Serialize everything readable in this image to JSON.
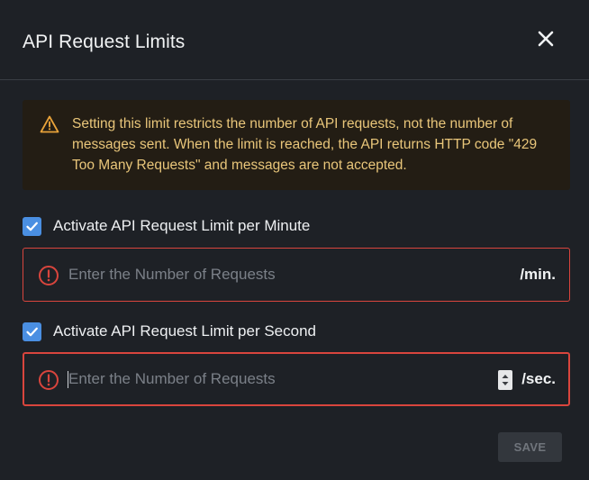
{
  "dialog": {
    "title": "API Request Limits",
    "close_icon": "close-icon"
  },
  "warning": {
    "icon": "warning-triangle-icon",
    "text": "Setting this limit restricts the number of API requests, not the number of messages sent. When the limit is reached, the API returns HTTP code \"429 Too Many Requests\" and messages are not accepted."
  },
  "per_minute": {
    "checkbox_checked": true,
    "label": "Activate API Request Limit per Minute",
    "input_value": "",
    "placeholder": "Enter the Number of Requests",
    "suffix": "/min.",
    "error_icon": "error-circle-icon"
  },
  "per_second": {
    "checkbox_checked": true,
    "label": "Activate API Request Limit per Second",
    "input_value": "",
    "placeholder": "Enter the Number of Requests",
    "suffix": "/sec.",
    "error_icon": "error-circle-icon",
    "spinner_icon": "stepper-arrows-icon"
  },
  "footer": {
    "save_label": "SAVE",
    "save_disabled": true
  },
  "colors": {
    "background": "#1e2126",
    "accent_blue": "#4a8fe2",
    "error_red": "#d9453d",
    "warning_text": "#e9c67a",
    "warning_bg": "#231d14"
  }
}
